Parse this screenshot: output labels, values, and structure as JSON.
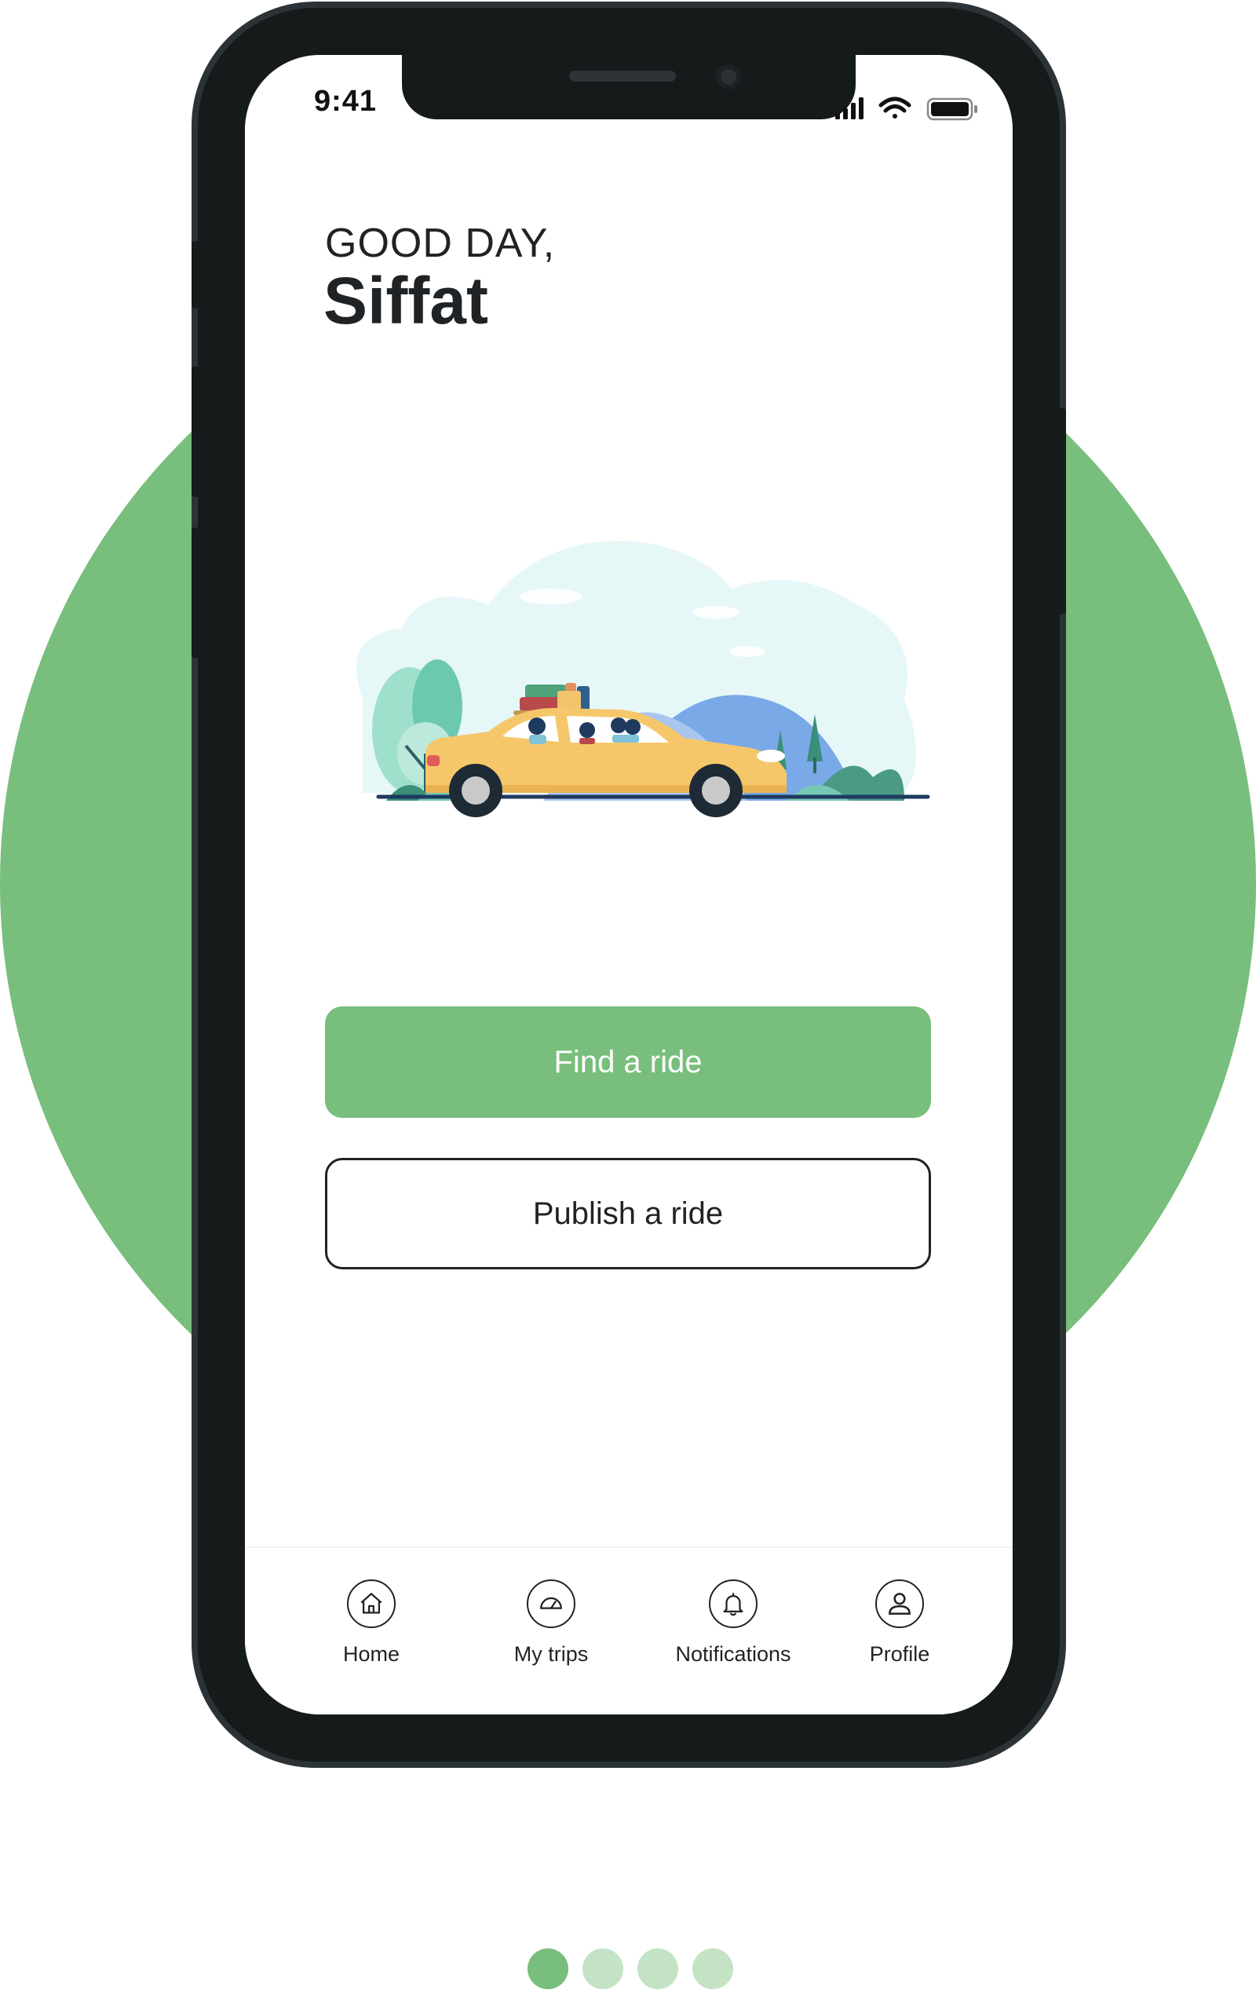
{
  "status_bar": {
    "time": "9:41",
    "icons": [
      "signal-icon",
      "wifi-icon",
      "battery-icon"
    ]
  },
  "greeting": {
    "line1": "GOOD DAY,",
    "name": "Siffat"
  },
  "illustration": {
    "icon": "family-road-trip-car-illustration"
  },
  "actions": {
    "find_label": "Find a ride",
    "publish_label": "Publish a ride"
  },
  "tabbar": {
    "items": [
      {
        "label": "Home",
        "icon": "home-icon"
      },
      {
        "label": "My trips",
        "icon": "speedometer-icon"
      },
      {
        "label": "Notifications",
        "icon": "bell-icon"
      },
      {
        "label": "Profile",
        "icon": "user-icon"
      }
    ]
  },
  "pagination": {
    "total": 4,
    "active_index": 0
  },
  "colors": {
    "brand_green": "#78be7c",
    "dot_inactive": "#c4e3c5",
    "phone_frame": "#151a1b",
    "text_dark": "#1f2326"
  }
}
